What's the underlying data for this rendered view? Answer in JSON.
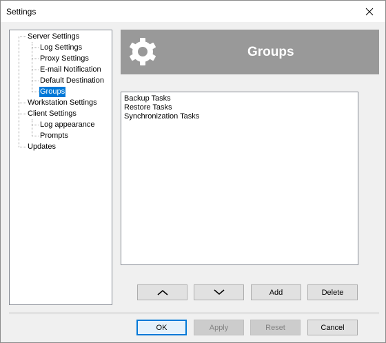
{
  "window": {
    "title": "Settings"
  },
  "tree": {
    "items": [
      {
        "label": "Server Settings",
        "selected": false
      },
      {
        "label": "Log Settings",
        "selected": false
      },
      {
        "label": "Proxy Settings",
        "selected": false
      },
      {
        "label": "E-mail Notification",
        "selected": false
      },
      {
        "label": "Default Destination",
        "selected": false
      },
      {
        "label": "Groups",
        "selected": true
      },
      {
        "label": "Workstation Settings",
        "selected": false
      },
      {
        "label": "Client Settings",
        "selected": false
      },
      {
        "label": "Log appearance",
        "selected": false
      },
      {
        "label": "Prompts",
        "selected": false
      },
      {
        "label": "Updates",
        "selected": false
      }
    ]
  },
  "header": {
    "title": "Groups",
    "icon": "gear-icon"
  },
  "groups_list": {
    "items": [
      "Backup Tasks",
      "Restore Tasks",
      "Synchronization Tasks"
    ]
  },
  "list_buttons": {
    "up_icon": "chevron-up-icon",
    "down_icon": "chevron-down-icon",
    "add_label": "Add",
    "delete_label": "Delete"
  },
  "dialog_buttons": {
    "ok_label": "OK",
    "apply_label": "Apply",
    "reset_label": "Reset",
    "cancel_label": "Cancel"
  },
  "colors": {
    "selection": "#0078d7",
    "header_bg": "#999999",
    "window_bg": "#f0f0f0"
  }
}
